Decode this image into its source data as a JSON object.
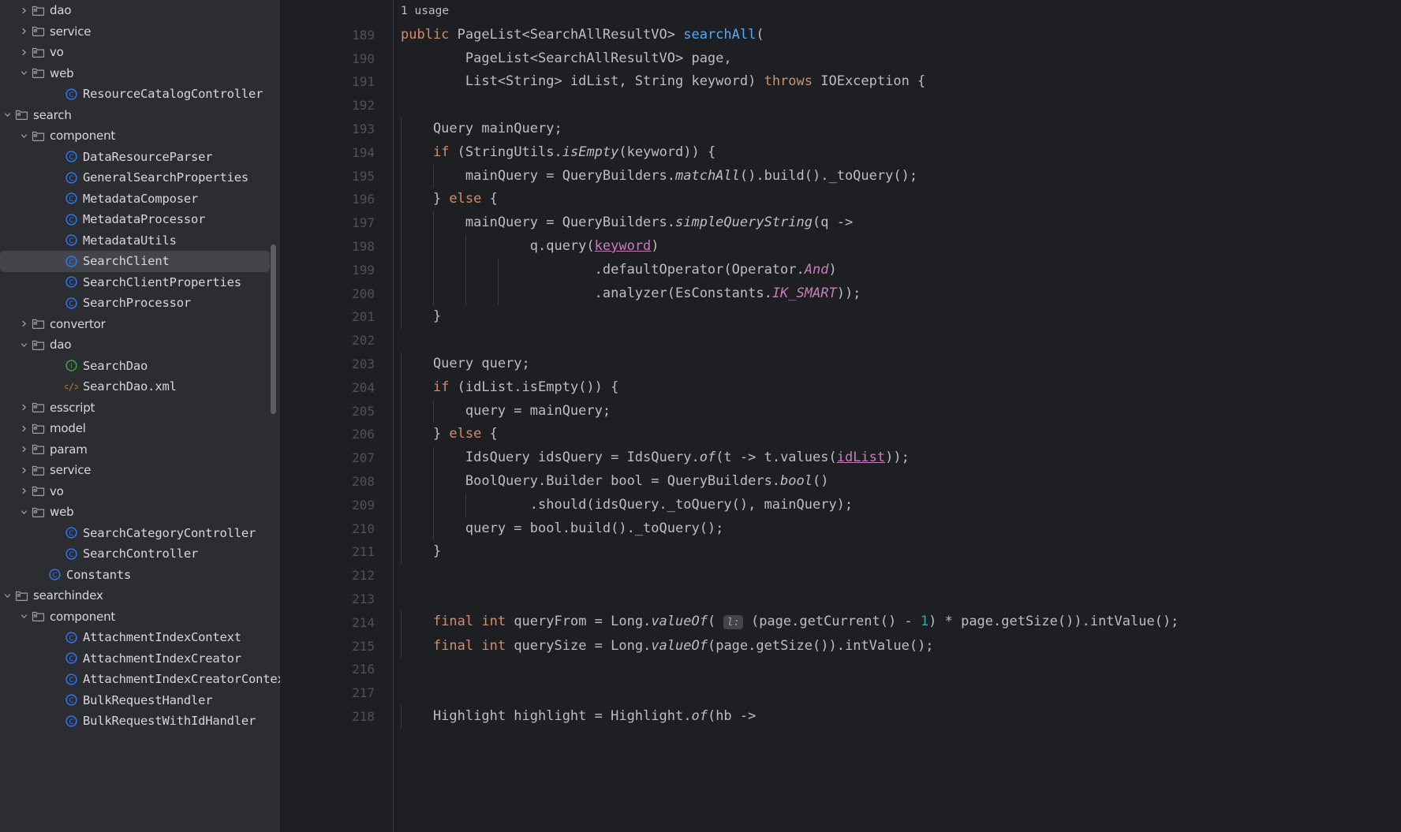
{
  "theme": {
    "sidebar_bg": "#2b2d30",
    "editor_bg": "#1e1f22",
    "selection_bg": "#43454a",
    "keyword_color": "#cf8e6d",
    "method_color": "#56a8f5",
    "constant_color": "#c77dbb",
    "number_color": "#2aacb8",
    "text_color": "#bcbec4",
    "line_number_color": "#4e5157"
  },
  "sidebar": {
    "items": [
      {
        "label": "dao",
        "indent": 1,
        "icon": "folder-icon",
        "arrow": "chevron-right",
        "selected": false
      },
      {
        "label": "service",
        "indent": 1,
        "icon": "folder-icon",
        "arrow": "chevron-right",
        "selected": false
      },
      {
        "label": "vo",
        "indent": 1,
        "icon": "folder-icon",
        "arrow": "chevron-right",
        "selected": false
      },
      {
        "label": "web",
        "indent": 1,
        "icon": "folder-icon",
        "arrow": "chevron-down",
        "selected": false
      },
      {
        "label": "ResourceCatalogController",
        "indent": 3,
        "icon": "class-icon",
        "arrow": "none",
        "selected": false
      },
      {
        "label": "search",
        "indent": 0,
        "icon": "folder-icon",
        "arrow": "chevron-down",
        "selected": false
      },
      {
        "label": "component",
        "indent": 1,
        "icon": "folder-icon",
        "arrow": "chevron-down",
        "selected": false
      },
      {
        "label": "DataResourceParser",
        "indent": 3,
        "icon": "class-icon",
        "arrow": "none",
        "selected": false
      },
      {
        "label": "GeneralSearchProperties",
        "indent": 3,
        "icon": "class-icon",
        "arrow": "none",
        "selected": false
      },
      {
        "label": "MetadataComposer",
        "indent": 3,
        "icon": "class-icon",
        "arrow": "none",
        "selected": false
      },
      {
        "label": "MetadataProcessor",
        "indent": 3,
        "icon": "class-icon",
        "arrow": "none",
        "selected": false
      },
      {
        "label": "MetadataUtils",
        "indent": 3,
        "icon": "class-icon",
        "arrow": "none",
        "selected": false
      },
      {
        "label": "SearchClient",
        "indent": 3,
        "icon": "class-icon",
        "arrow": "none",
        "selected": true
      },
      {
        "label": "SearchClientProperties",
        "indent": 3,
        "icon": "class-icon",
        "arrow": "none",
        "selected": false
      },
      {
        "label": "SearchProcessor",
        "indent": 3,
        "icon": "class-icon",
        "arrow": "none",
        "selected": false
      },
      {
        "label": "convertor",
        "indent": 1,
        "icon": "folder-icon",
        "arrow": "chevron-right",
        "selected": false
      },
      {
        "label": "dao",
        "indent": 1,
        "icon": "folder-icon",
        "arrow": "chevron-down",
        "selected": false
      },
      {
        "label": "SearchDao",
        "indent": 3,
        "icon": "interface-icon",
        "arrow": "none",
        "selected": false
      },
      {
        "label": "SearchDao.xml",
        "indent": 3,
        "icon": "xml-icon",
        "arrow": "none",
        "selected": false
      },
      {
        "label": "esscript",
        "indent": 1,
        "icon": "folder-icon",
        "arrow": "chevron-right",
        "selected": false
      },
      {
        "label": "model",
        "indent": 1,
        "icon": "folder-icon",
        "arrow": "chevron-right",
        "selected": false
      },
      {
        "label": "param",
        "indent": 1,
        "icon": "folder-icon",
        "arrow": "chevron-right",
        "selected": false
      },
      {
        "label": "service",
        "indent": 1,
        "icon": "folder-icon",
        "arrow": "chevron-right",
        "selected": false
      },
      {
        "label": "vo",
        "indent": 1,
        "icon": "folder-icon",
        "arrow": "chevron-right",
        "selected": false
      },
      {
        "label": "web",
        "indent": 1,
        "icon": "folder-icon",
        "arrow": "chevron-down",
        "selected": false
      },
      {
        "label": "SearchCategoryController",
        "indent": 3,
        "icon": "class-icon",
        "arrow": "none",
        "selected": false
      },
      {
        "label": "SearchController",
        "indent": 3,
        "icon": "class-icon",
        "arrow": "none",
        "selected": false
      },
      {
        "label": "Constants",
        "indent": 2,
        "icon": "class-icon",
        "arrow": "none",
        "selected": false
      },
      {
        "label": "searchindex",
        "indent": 0,
        "icon": "folder-icon",
        "arrow": "chevron-down",
        "selected": false
      },
      {
        "label": "component",
        "indent": 1,
        "icon": "folder-icon",
        "arrow": "chevron-down",
        "selected": false
      },
      {
        "label": "AttachmentIndexContext",
        "indent": 3,
        "icon": "class-icon",
        "arrow": "none",
        "selected": false
      },
      {
        "label": "AttachmentIndexCreator",
        "indent": 3,
        "icon": "class-icon",
        "arrow": "none",
        "selected": false
      },
      {
        "label": "AttachmentIndexCreatorContext",
        "indent": 3,
        "icon": "class-icon",
        "arrow": "none",
        "selected": false
      },
      {
        "label": "BulkRequestHandler",
        "indent": 3,
        "icon": "class-icon",
        "arrow": "none",
        "selected": false
      },
      {
        "label": "BulkRequestWithIdHandler",
        "indent": 3,
        "icon": "class-icon",
        "arrow": "none",
        "selected": false
      }
    ]
  },
  "editor": {
    "usage_hint": "1 usage",
    "first_line_number": 189,
    "lines": [
      {
        "num": "",
        "indent": 0,
        "hint": true,
        "tokens": [
          {
            "t": "1 usage",
            "c": "plain"
          }
        ]
      },
      {
        "num": "189",
        "indent": 0,
        "tokens": [
          {
            "t": "public ",
            "c": "kw"
          },
          {
            "t": "PageList<SearchAllResultVO> ",
            "c": "plain"
          },
          {
            "t": "searchAll",
            "c": "fn"
          },
          {
            "t": "(",
            "c": "plain"
          }
        ]
      },
      {
        "num": "190",
        "indent": 0,
        "tokens": [
          {
            "t": "        PageList<SearchAllResultVO> page,",
            "c": "plain"
          }
        ]
      },
      {
        "num": "191",
        "indent": 0,
        "tokens": [
          {
            "t": "        List<String> idList, String keyword) ",
            "c": "plain"
          },
          {
            "t": "throws ",
            "c": "kw"
          },
          {
            "t": "IOException {",
            "c": "plain"
          }
        ]
      },
      {
        "num": "192",
        "indent": 0,
        "tokens": []
      },
      {
        "num": "193",
        "indent": 1,
        "tokens": [
          {
            "t": "    Query mainQuery;",
            "c": "plain"
          }
        ]
      },
      {
        "num": "194",
        "indent": 1,
        "tokens": [
          {
            "t": "    ",
            "c": "plain"
          },
          {
            "t": "if",
            "c": "kw"
          },
          {
            "t": " (StringUtils.",
            "c": "plain"
          },
          {
            "t": "isEmpty",
            "c": "sm"
          },
          {
            "t": "(keyword)) {",
            "c": "plain"
          }
        ]
      },
      {
        "num": "195",
        "indent": 2,
        "tokens": [
          {
            "t": "        mainQuery = QueryBuilders.",
            "c": "plain"
          },
          {
            "t": "matchAll",
            "c": "sm"
          },
          {
            "t": "().build()._toQuery();",
            "c": "plain"
          }
        ]
      },
      {
        "num": "196",
        "indent": 1,
        "tokens": [
          {
            "t": "    } ",
            "c": "plain"
          },
          {
            "t": "else",
            "c": "kw"
          },
          {
            "t": " {",
            "c": "plain"
          }
        ]
      },
      {
        "num": "197",
        "indent": 2,
        "tokens": [
          {
            "t": "        mainQuery = QueryBuilders.",
            "c": "plain"
          },
          {
            "t": "simpleQueryString",
            "c": "sm"
          },
          {
            "t": "(q ->",
            "c": "plain"
          }
        ]
      },
      {
        "num": "198",
        "indent": 3,
        "tokens": [
          {
            "t": "                q.query(",
            "c": "plain"
          },
          {
            "t": "keyword",
            "c": "par"
          },
          {
            "t": ")",
            "c": "plain"
          }
        ]
      },
      {
        "num": "199",
        "indent": 4,
        "tokens": [
          {
            "t": "                        .defaultOperator(Operator.",
            "c": "plain"
          },
          {
            "t": "And",
            "c": "cst"
          },
          {
            "t": ")",
            "c": "plain"
          }
        ]
      },
      {
        "num": "200",
        "indent": 4,
        "tokens": [
          {
            "t": "                        .analyzer(EsConstants.",
            "c": "plain"
          },
          {
            "t": "IK_SMART",
            "c": "cst"
          },
          {
            "t": "));",
            "c": "plain"
          }
        ]
      },
      {
        "num": "201",
        "indent": 1,
        "tokens": [
          {
            "t": "    }",
            "c": "plain"
          }
        ]
      },
      {
        "num": "202",
        "indent": 0,
        "tokens": []
      },
      {
        "num": "203",
        "indent": 1,
        "tokens": [
          {
            "t": "    Query query;",
            "c": "plain"
          }
        ]
      },
      {
        "num": "204",
        "indent": 1,
        "tokens": [
          {
            "t": "    ",
            "c": "plain"
          },
          {
            "t": "if",
            "c": "kw"
          },
          {
            "t": " (idList.isEmpty()) {",
            "c": "plain"
          }
        ]
      },
      {
        "num": "205",
        "indent": 2,
        "tokens": [
          {
            "t": "        query = mainQuery;",
            "c": "plain"
          }
        ]
      },
      {
        "num": "206",
        "indent": 1,
        "tokens": [
          {
            "t": "    } ",
            "c": "plain"
          },
          {
            "t": "else",
            "c": "kw"
          },
          {
            "t": " {",
            "c": "plain"
          }
        ]
      },
      {
        "num": "207",
        "indent": 2,
        "tokens": [
          {
            "t": "        IdsQuery idsQuery = IdsQuery.",
            "c": "plain"
          },
          {
            "t": "of",
            "c": "sm"
          },
          {
            "t": "(t -> t.values(",
            "c": "plain"
          },
          {
            "t": "idList",
            "c": "par"
          },
          {
            "t": "));",
            "c": "plain"
          }
        ]
      },
      {
        "num": "208",
        "indent": 2,
        "tokens": [
          {
            "t": "        BoolQuery.Builder bool = QueryBuilders.",
            "c": "plain"
          },
          {
            "t": "bool",
            "c": "sm"
          },
          {
            "t": "()",
            "c": "plain"
          }
        ]
      },
      {
        "num": "209",
        "indent": 3,
        "tokens": [
          {
            "t": "                .should(idsQuery._toQuery(), mainQuery);",
            "c": "plain"
          }
        ]
      },
      {
        "num": "210",
        "indent": 2,
        "tokens": [
          {
            "t": "        query = bool.build()._toQuery();",
            "c": "plain"
          }
        ]
      },
      {
        "num": "211",
        "indent": 1,
        "tokens": [
          {
            "t": "    }",
            "c": "plain"
          }
        ]
      },
      {
        "num": "212",
        "indent": 0,
        "tokens": []
      },
      {
        "num": "213",
        "indent": 0,
        "tokens": []
      },
      {
        "num": "214",
        "indent": 1,
        "tokens": [
          {
            "t": "    ",
            "c": "plain"
          },
          {
            "t": "final int ",
            "c": "kw"
          },
          {
            "t": "queryFrom = Long.",
            "c": "plain"
          },
          {
            "t": "valueOf",
            "c": "sm"
          },
          {
            "t": "( ",
            "c": "plain"
          },
          {
            "t": "l:",
            "c": "inlay"
          },
          {
            "t": " (page.getCurrent() - ",
            "c": "plain"
          },
          {
            "t": "1",
            "c": "num"
          },
          {
            "t": ") * page.getSize()).intValue();",
            "c": "plain"
          }
        ]
      },
      {
        "num": "215",
        "indent": 1,
        "tokens": [
          {
            "t": "    ",
            "c": "plain"
          },
          {
            "t": "final int ",
            "c": "kw"
          },
          {
            "t": "querySize = Long.",
            "c": "plain"
          },
          {
            "t": "valueOf",
            "c": "sm"
          },
          {
            "t": "(page.getSize()).intValue();",
            "c": "plain"
          }
        ]
      },
      {
        "num": "216",
        "indent": 0,
        "tokens": []
      },
      {
        "num": "217",
        "indent": 0,
        "tokens": []
      },
      {
        "num": "218",
        "indent": 1,
        "tokens": [
          {
            "t": "    Highlight highlight = Highlight.",
            "c": "plain"
          },
          {
            "t": "of",
            "c": "sm"
          },
          {
            "t": "(hb ->",
            "c": "plain"
          }
        ]
      }
    ]
  }
}
